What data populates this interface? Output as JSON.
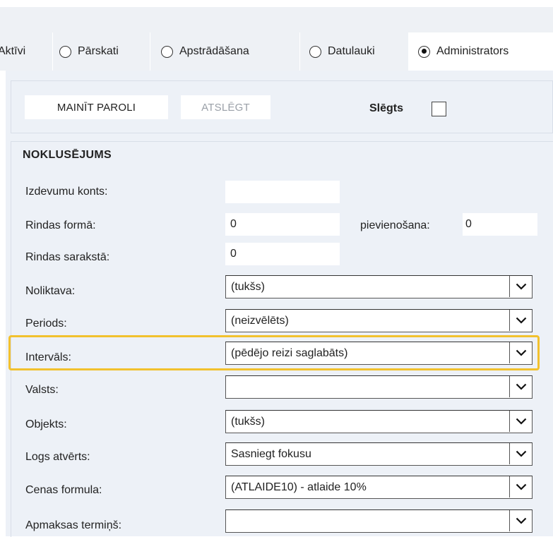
{
  "tabs": [
    {
      "label": "Aktīvi",
      "selected": false
    },
    {
      "label": "Pārskati",
      "selected": false
    },
    {
      "label": "Apstrādāšana",
      "selected": false
    },
    {
      "label": "Datulauki",
      "selected": false
    },
    {
      "label": "Administrators",
      "selected": true
    }
  ],
  "toolbar": {
    "change_password": "MAINĪT PAROLI",
    "unlock": "ATSLĒGT",
    "closed_label": "Slēgts",
    "closed_checked": false
  },
  "section": {
    "title": "NOKLUSĒJUMS",
    "fields": [
      {
        "label": "Izdevumu konts:",
        "type": "text",
        "value": ""
      },
      {
        "label": "Rindas formā:",
        "type": "text",
        "value": "0",
        "extra_label": "pievienošana:",
        "extra_value": "0"
      },
      {
        "label": "Rindas sarakstā:",
        "type": "text",
        "value": "0"
      },
      {
        "label": "Noliktava:",
        "type": "select",
        "value": "(tukšs)"
      },
      {
        "label": "Periods:",
        "type": "select",
        "value": "(neizvēlēts)"
      },
      {
        "label": "Intervāls:",
        "type": "select",
        "value": "(pēdējo reizi saglabāts)",
        "highlighted": true
      },
      {
        "label": "Valsts:",
        "type": "select",
        "value": ""
      },
      {
        "label": "Objekts:",
        "type": "select",
        "value": "(tukšs)"
      },
      {
        "label": "Logs atvērts:",
        "type": "select",
        "value": "Sasniegt fokusu"
      },
      {
        "label": "Cenas formula:",
        "type": "select",
        "value": "(ATLAIDE10) - atlaide 10%"
      },
      {
        "label": "Apmaksas termiņš:",
        "type": "select",
        "value": ""
      }
    ]
  },
  "colors": {
    "highlight": "#f2c12e",
    "panel": "#edf1f7",
    "tabbar": "#eef1f5"
  }
}
